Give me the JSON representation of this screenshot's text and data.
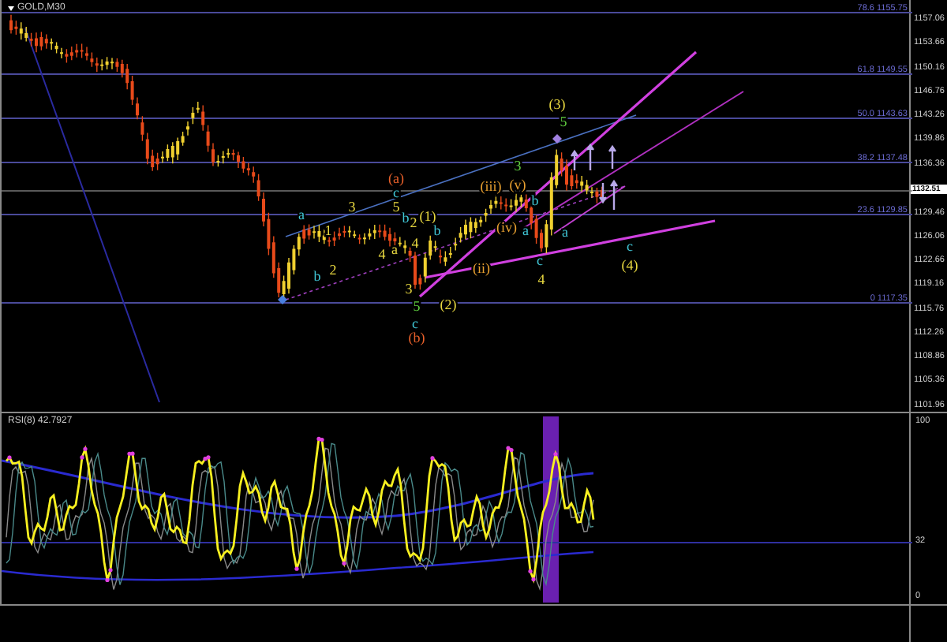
{
  "chart": {
    "symbol": "GOLD,M30",
    "price_axis": [
      "1157.06",
      "1153.66",
      "1150.16",
      "1146.76",
      "1143.26",
      "1139.86",
      "1136.36",
      "1129.46",
      "1126.06",
      "1122.66",
      "1119.16",
      "1115.76",
      "1112.26",
      "1108.86",
      "1105.36",
      "1101.96"
    ],
    "current_price": "1132.51",
    "fib_levels": [
      {
        "label": "78.6 1155.75"
      },
      {
        "label": "61.8 1149.55"
      },
      {
        "label": "50.0 1143.63"
      },
      {
        "label": "38.2 1137.48"
      },
      {
        "label": "23.6 1129.85"
      },
      {
        "label": "0 1117.35"
      }
    ],
    "wave_labels": [
      {
        "text": "(a)",
        "color": "#e8602a"
      },
      {
        "text": "c",
        "color": "#40c8d8"
      },
      {
        "text": "5",
        "color": "#e8d840"
      },
      {
        "text": "b",
        "color": "#40c8d8"
      },
      {
        "text": "2",
        "color": "#e8d840"
      },
      {
        "text": "(1)",
        "color": "#e8d840"
      },
      {
        "text": "b",
        "color": "#40c8d8"
      },
      {
        "text": "4",
        "color": "#e8d840"
      },
      {
        "text": "a",
        "color": "#e8d840"
      },
      {
        "text": "3",
        "color": "#e8d840"
      },
      {
        "text": "5",
        "color": "#60d040"
      },
      {
        "text": "c",
        "color": "#40c8d8"
      },
      {
        "text": "(b)",
        "color": "#e8602a"
      },
      {
        "text": "(2)",
        "color": "#e8d840"
      },
      {
        "text": "a",
        "color": "#40c8d8"
      },
      {
        "text": "3",
        "color": "#e8d840"
      },
      {
        "text": "1",
        "color": "#e8d840"
      },
      {
        "text": "b",
        "color": "#40c8d8"
      },
      {
        "text": "2",
        "color": "#e8d840"
      },
      {
        "text": "4",
        "color": "#e8d840"
      },
      {
        "text": "(iii)",
        "color": "#e8a030"
      },
      {
        "text": "3",
        "color": "#60d040"
      },
      {
        "text": "(v)",
        "color": "#e8a030"
      },
      {
        "text": "(iv)",
        "color": "#e8a030"
      },
      {
        "text": "b",
        "color": "#40c8d8"
      },
      {
        "text": "a",
        "color": "#40c8d8"
      },
      {
        "text": "(ii)",
        "color": "#e8a030"
      },
      {
        "text": "(3)",
        "color": "#e8d840"
      },
      {
        "text": "5",
        "color": "#60d040"
      },
      {
        "text": "c",
        "color": "#40c8d8"
      },
      {
        "text": "4",
        "color": "#e8d840"
      },
      {
        "text": "a",
        "color": "#40c8d8"
      },
      {
        "text": "c",
        "color": "#40c8d8"
      },
      {
        "text": "(4)",
        "color": "#e8d840"
      }
    ]
  },
  "rsi": {
    "title": "RSI(8) 42.7927",
    "axis": [
      "100",
      "32",
      "0"
    ]
  }
}
